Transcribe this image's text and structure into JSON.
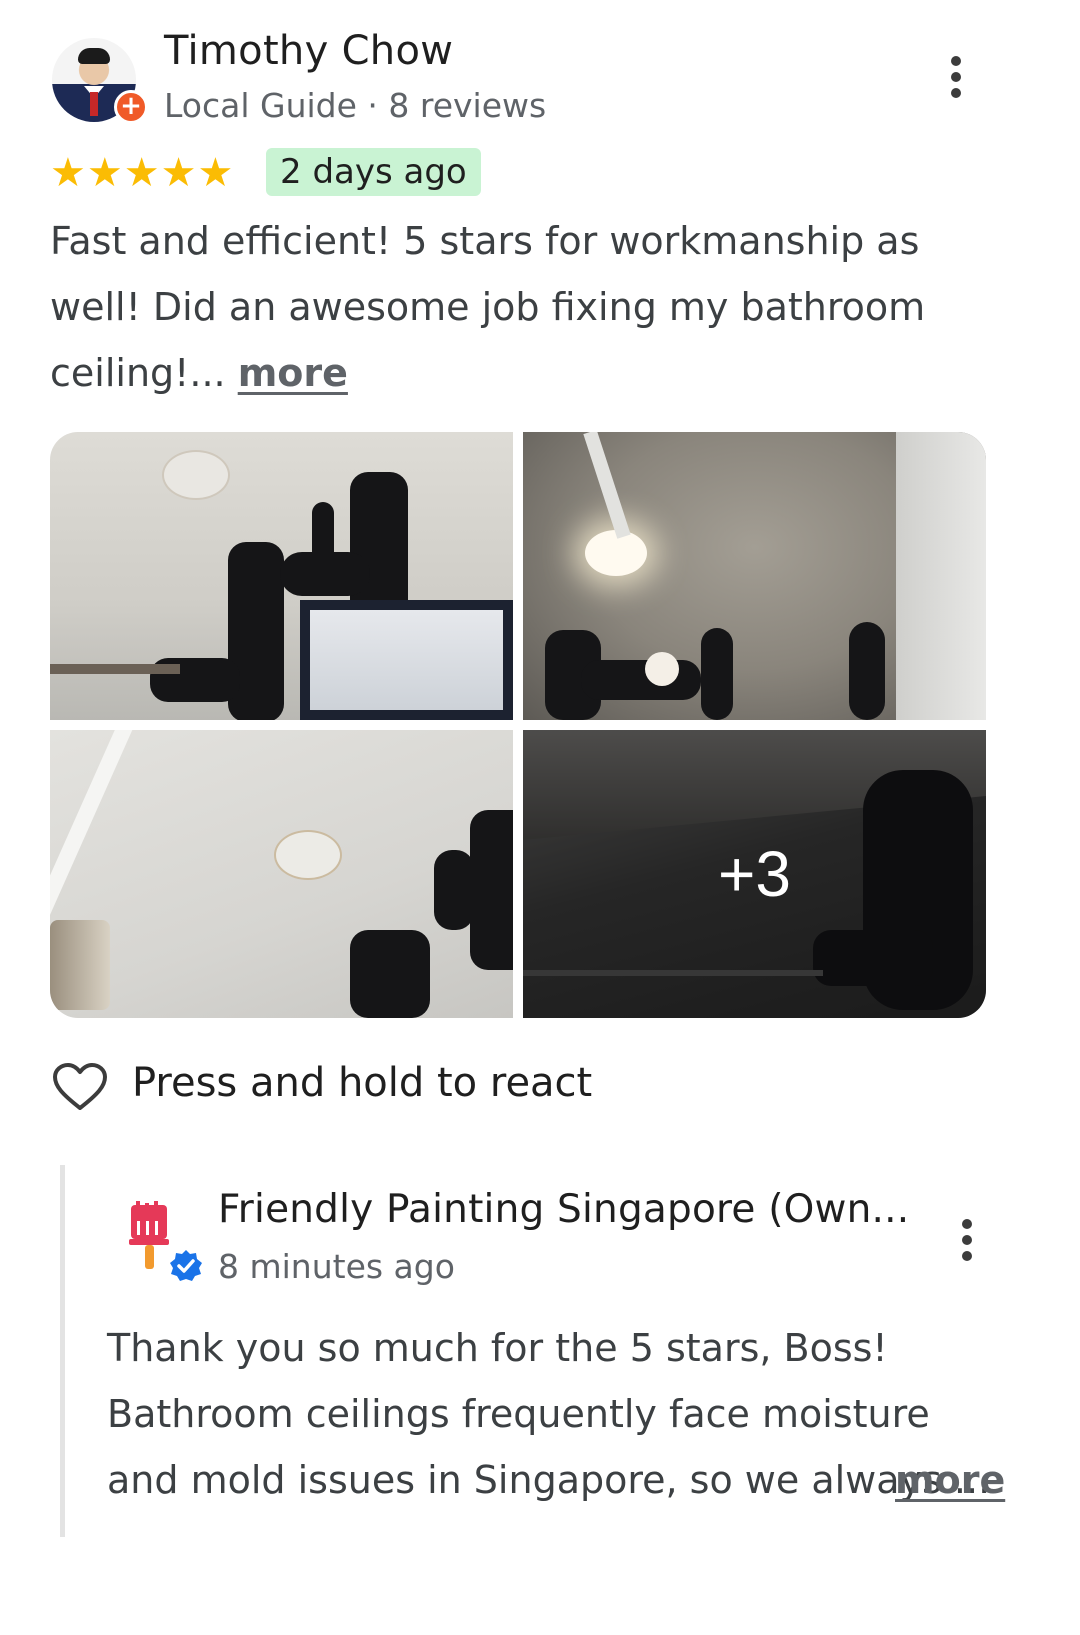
{
  "review": {
    "reviewer_name": "Timothy Chow",
    "reviewer_meta": "Local Guide · 8 reviews",
    "rating": 5,
    "stars": "★★★★★",
    "date": "2 days ago",
    "text": "Fast and efficient! 5 stars for workmanship as well! Did an awesome job fixing my bathroom ceiling!... ",
    "more_label": "more"
  },
  "photos": {
    "extra_count": "+3"
  },
  "reaction": {
    "label": "Press and hold to react"
  },
  "owner_reply": {
    "name": "Friendly Painting Singapore (Own...",
    "time": "8 minutes ago",
    "text": "Thank you so much for the 5 stars, Boss! Bathroom ceilings frequently face moisture and mold issues in Singapore, so we always ...",
    "more_label": "more"
  },
  "colors": {
    "star": "#fbbc04",
    "date_badge_bg": "#c9f3d3",
    "local_guide_badge": "#f05a28",
    "verified": "#1a73e8"
  }
}
